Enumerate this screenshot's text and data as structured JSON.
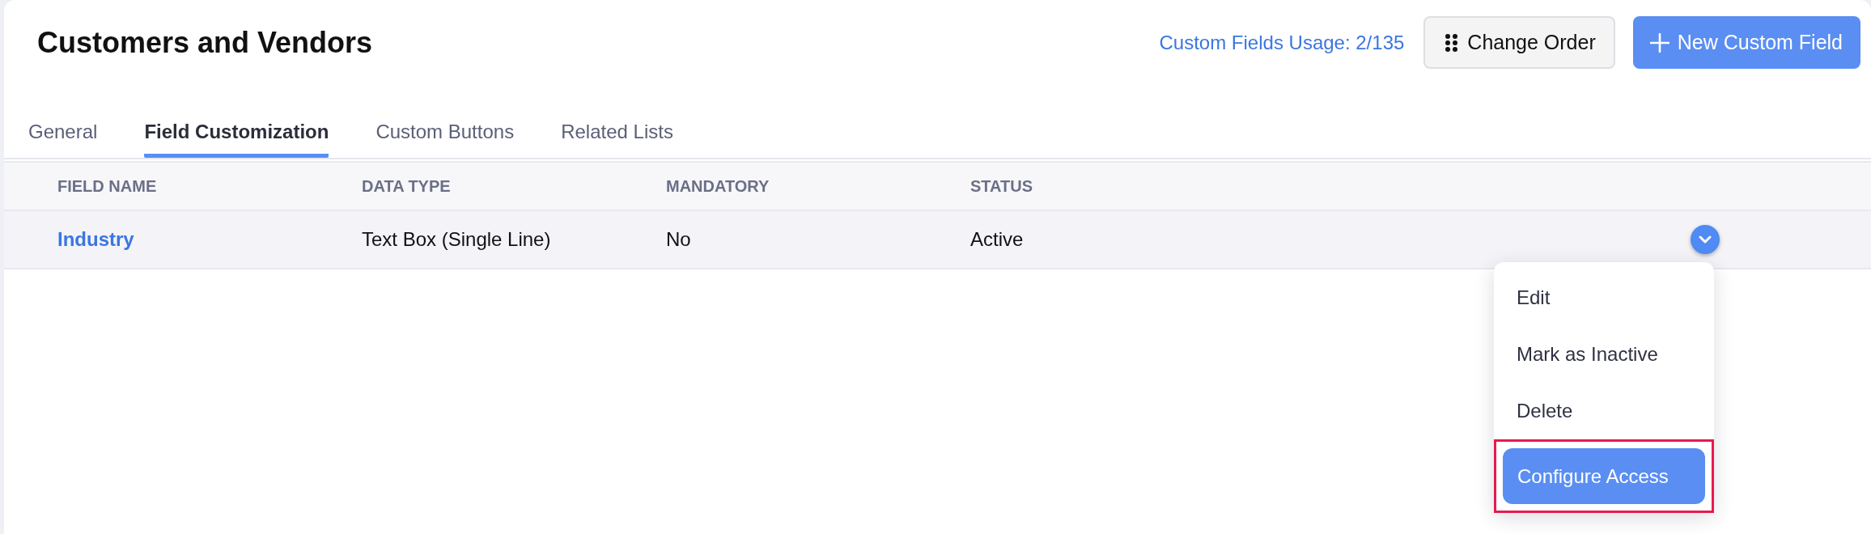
{
  "page": {
    "title": "Customers and Vendors"
  },
  "header_actions": {
    "usage_link": "Custom Fields Usage: 2/135",
    "buttons": [
      {
        "label": "Change Order",
        "kind": "secondary"
      },
      {
        "label": "New Custom Field",
        "kind": "primary"
      }
    ]
  },
  "tabs": [
    {
      "label": "General",
      "selected": false
    },
    {
      "label": "Field Customization",
      "selected": true
    },
    {
      "label": "Custom Buttons",
      "selected": false
    },
    {
      "label": "Related Lists",
      "selected": false
    }
  ],
  "table": {
    "columns": [
      "FIELD NAME",
      "DATA TYPE",
      "MANDATORY",
      "STATUS"
    ],
    "rows": [
      {
        "cells": [
          "Industry",
          "Text Box (Single Line)",
          "No",
          "Active"
        ],
        "actions_menu": {
          "expanded": true,
          "items": [
            {
              "label": "Edit",
              "selected": false,
              "highlighted": false
            },
            {
              "label": "Mark as Inactive",
              "selected": false,
              "highlighted": false
            },
            {
              "label": "Delete",
              "selected": false,
              "highlighted": false
            },
            {
              "label": "Configure Access",
              "selected": true,
              "highlighted": true
            }
          ]
        }
      }
    ]
  }
}
